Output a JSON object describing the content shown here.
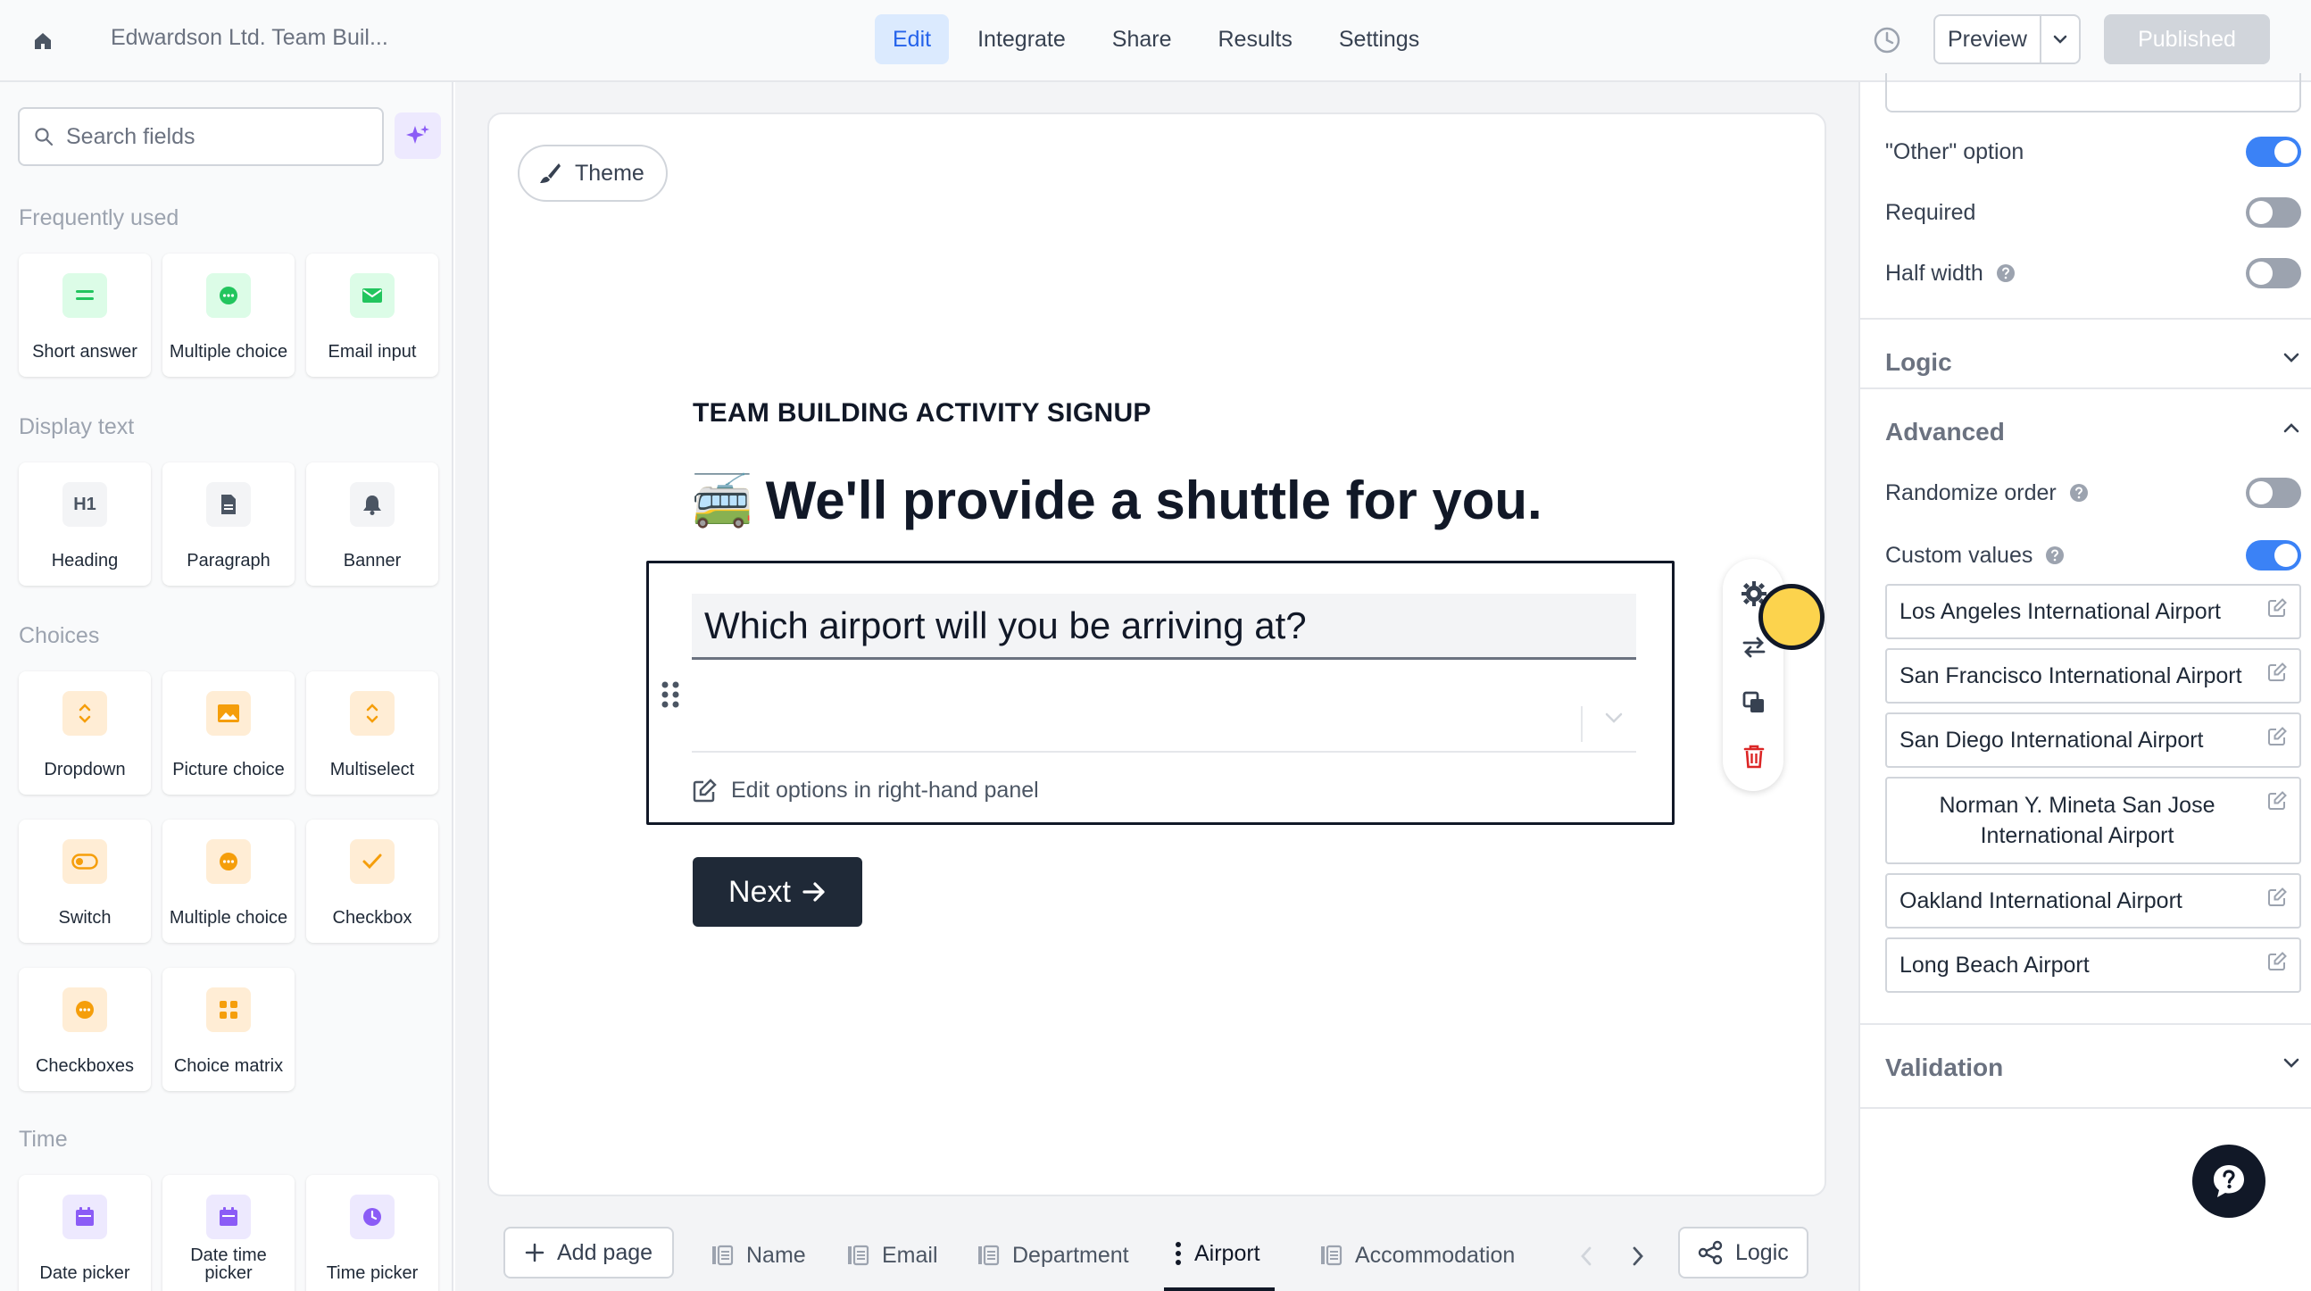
{
  "topbar": {
    "doc_title": "Edwardson Ltd. Team Buil...",
    "tabs": [
      {
        "label": "Edit",
        "active": true
      },
      {
        "label": "Integrate",
        "active": false
      },
      {
        "label": "Share",
        "active": false
      },
      {
        "label": "Results",
        "active": false
      },
      {
        "label": "Settings",
        "active": false
      }
    ],
    "preview_label": "Preview",
    "publish_label": "Published"
  },
  "sidebar": {
    "search_placeholder": "Search fields",
    "sections": [
      {
        "label": "Frequently used",
        "items": [
          {
            "label": "Short answer",
            "icon": "short-answer-icon",
            "color": "green"
          },
          {
            "label": "Multiple choice",
            "icon": "multiple-choice-icon",
            "color": "green"
          },
          {
            "label": "Email input",
            "icon": "email-icon",
            "color": "green"
          }
        ]
      },
      {
        "label": "Display text",
        "items": [
          {
            "label": "Heading",
            "icon": "heading-icon",
            "color": "gray"
          },
          {
            "label": "Paragraph",
            "icon": "paragraph-icon",
            "color": "gray"
          },
          {
            "label": "Banner",
            "icon": "bell-icon",
            "color": "gray"
          }
        ]
      },
      {
        "label": "Choices",
        "items": [
          {
            "label": "Dropdown",
            "icon": "dropdown-icon",
            "color": "orange"
          },
          {
            "label": "Picture choice",
            "icon": "picture-icon",
            "color": "orange"
          },
          {
            "label": "Multiselect",
            "icon": "multiselect-icon",
            "color": "orange"
          },
          {
            "label": "Switch",
            "icon": "switch-icon",
            "color": "orange"
          },
          {
            "label": "Multiple choice",
            "icon": "multiple-choice-icon",
            "color": "orange"
          },
          {
            "label": "Checkbox",
            "icon": "checkbox-icon",
            "color": "orange"
          },
          {
            "label": "Checkboxes",
            "icon": "checkboxes-icon",
            "color": "orange"
          },
          {
            "label": "Choice matrix",
            "icon": "matrix-icon",
            "color": "orange"
          }
        ]
      },
      {
        "label": "Time",
        "items": [
          {
            "label": "Date picker",
            "icon": "calendar-icon",
            "color": "purple"
          },
          {
            "label": "Date time picker",
            "icon": "calendar-icon",
            "color": "purple"
          },
          {
            "label": "Time picker",
            "icon": "clock-icon",
            "color": "purple"
          }
        ]
      }
    ]
  },
  "canvas": {
    "theme_label": "Theme",
    "kicker": "TEAM BUILDING ACTIVITY SIGNUP",
    "heading_emoji": "🚎",
    "heading": "We'll provide a shuttle for you.",
    "question": "Which airport will you be arriving at?",
    "edit_hint": "Edit options in right-hand panel",
    "next_label": "Next"
  },
  "pagebar": {
    "add_page": "Add page",
    "pages": [
      {
        "label": "Name",
        "active": false
      },
      {
        "label": "Email",
        "active": false
      },
      {
        "label": "Department",
        "active": false
      },
      {
        "label": "Airport",
        "active": true
      },
      {
        "label": "Accommodation",
        "active": false
      }
    ],
    "logic_label": "Logic"
  },
  "panel": {
    "other_option": {
      "label": "\"Other\" option",
      "on": true
    },
    "required": {
      "label": "Required",
      "on": false
    },
    "half_width": {
      "label": "Half width",
      "on": false
    },
    "logic_heading": "Logic",
    "advanced_heading": "Advanced",
    "randomize": {
      "label": "Randomize order",
      "on": false
    },
    "custom_values": {
      "label": "Custom values",
      "on": true
    },
    "values": [
      "Los Angeles International Airport",
      "San Francisco International Airport",
      "San Diego International Airport",
      "Norman Y. Mineta San Jose International Airport",
      "Oakland International Airport",
      "Long Beach Airport"
    ],
    "validation_heading": "Validation"
  },
  "colors": {
    "accent": "#2563eb",
    "toggle_on": "#3b82f6",
    "cursor": "#fcd34d"
  }
}
